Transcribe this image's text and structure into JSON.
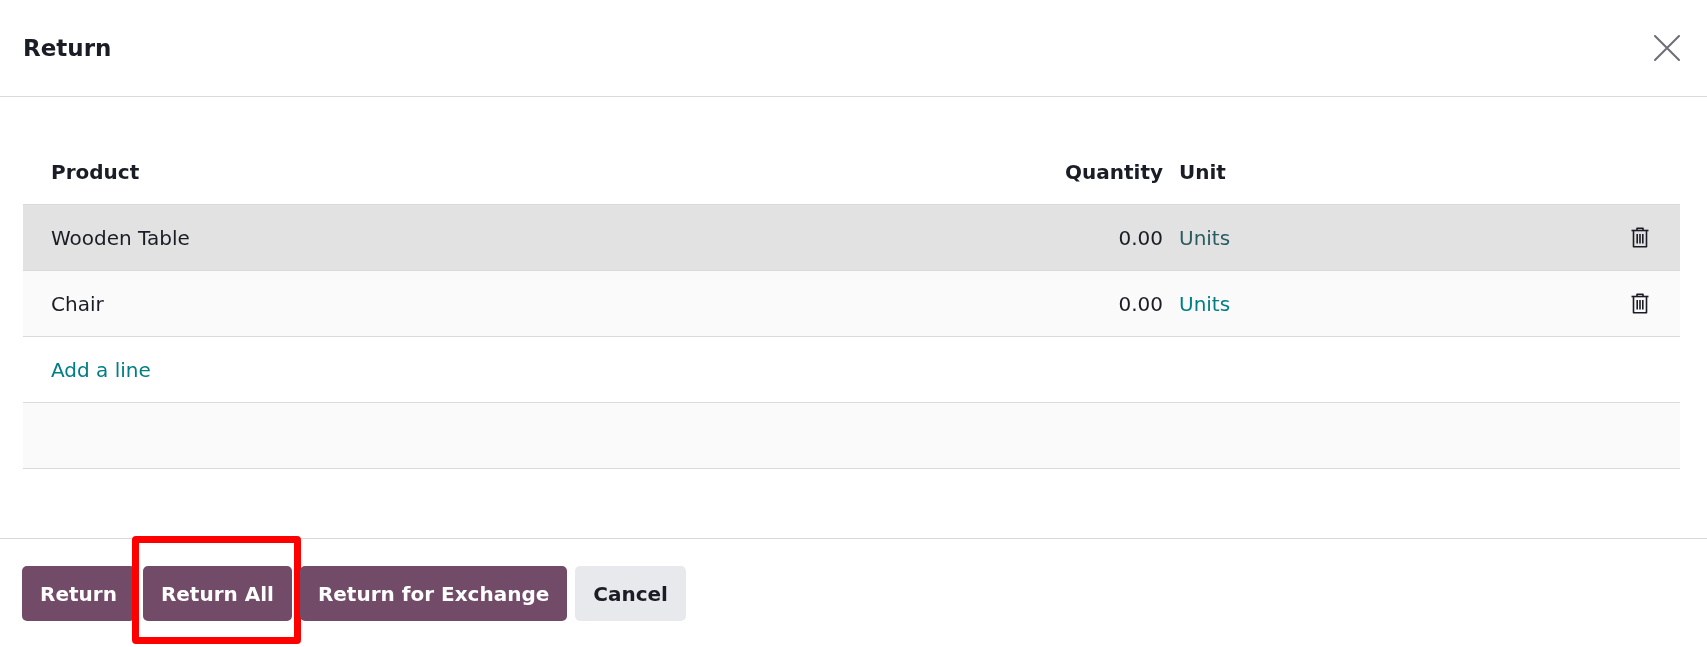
{
  "dialog": {
    "title": "Return"
  },
  "table": {
    "columns": [
      "Product",
      "Quantity",
      "Unit"
    ],
    "rows": [
      {
        "product": "Wooden Table",
        "quantity": "0.00",
        "unit": "Units",
        "highlighted": true
      },
      {
        "product": "Chair",
        "quantity": "0.00",
        "unit": "Units",
        "highlighted": false
      }
    ],
    "add_line_link": "Add a line"
  },
  "buttons": [
    {
      "label": "Return",
      "kind": "primary",
      "highlighted": false
    },
    {
      "label": "Return All",
      "kind": "primary",
      "highlighted": true
    },
    {
      "label": "Return for Exchange",
      "kind": "primary",
      "highlighted": false
    },
    {
      "label": "Cancel",
      "kind": "secondary",
      "highlighted": false
    }
  ]
}
